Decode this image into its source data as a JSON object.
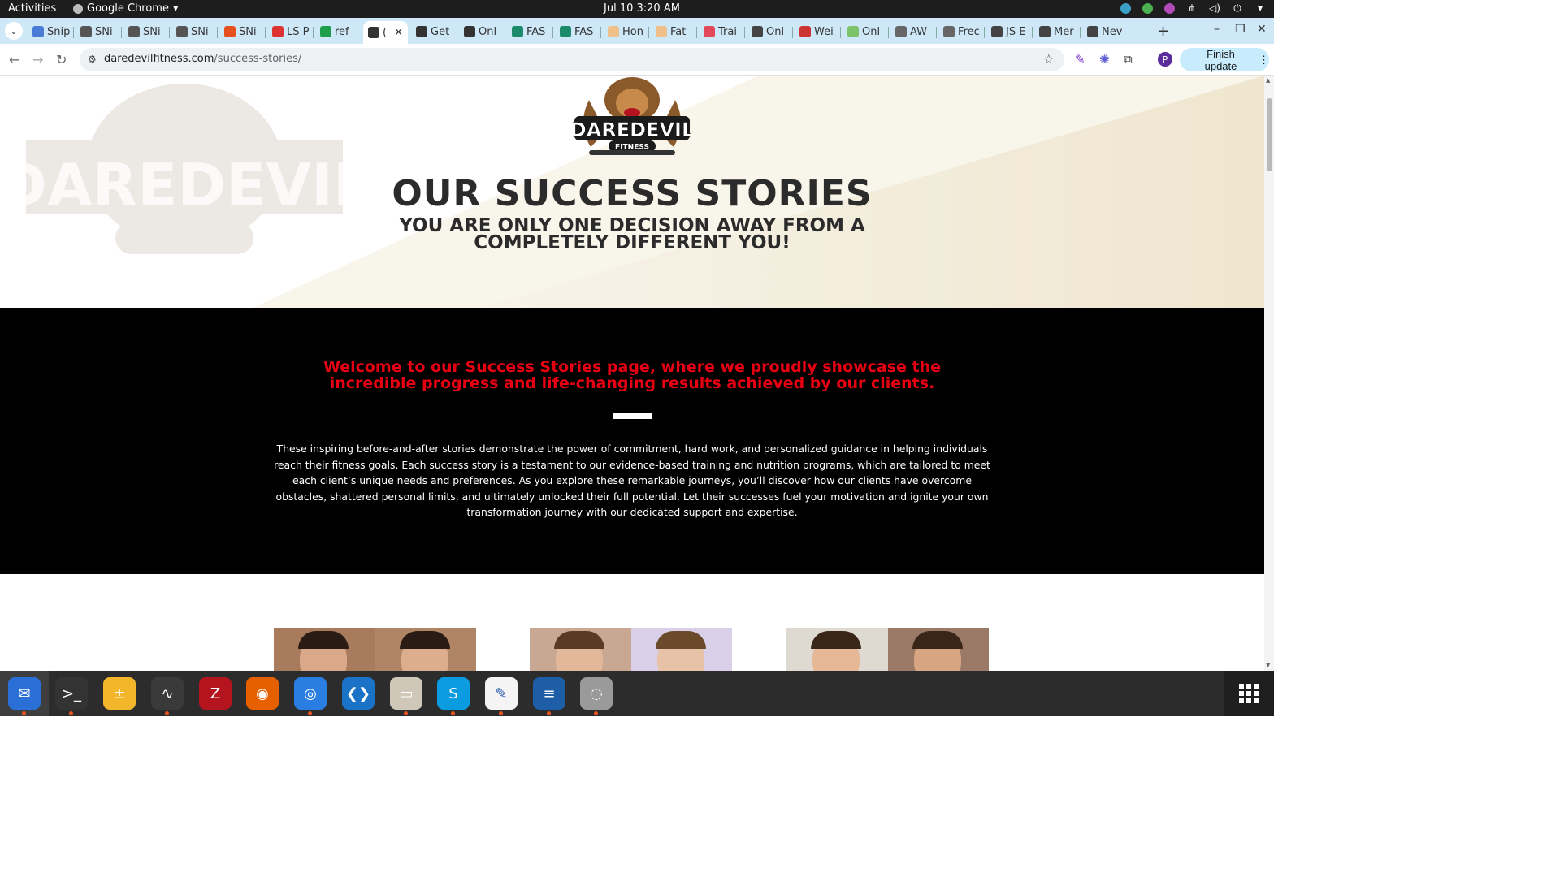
{
  "topbar": {
    "activities": "Activities",
    "app_name": "Google Chrome",
    "clock": "Jul 10  3:20 AM"
  },
  "tabs": [
    {
      "label": "Snip",
      "color": "#4a7bd6"
    },
    {
      "label": "SNi",
      "color": "#555"
    },
    {
      "label": "SNi",
      "color": "#555"
    },
    {
      "label": "SNi",
      "color": "#555"
    },
    {
      "label": "SNi",
      "color": "#e5501e"
    },
    {
      "label": "LS P",
      "color": "#d33"
    },
    {
      "label": "ref",
      "color": "#1e9d4b"
    },
    {
      "label": "(",
      "color": "#333",
      "active": true
    },
    {
      "label": "Get",
      "color": "#333"
    },
    {
      "label": "Onl",
      "color": "#333"
    },
    {
      "label": "FAS",
      "color": "#1d8a6b"
    },
    {
      "label": "FAS",
      "color": "#1d8a6b"
    },
    {
      "label": "Hon",
      "color": "#f0c08a"
    },
    {
      "label": "Fat",
      "color": "#f0c08a"
    },
    {
      "label": "Trai",
      "color": "#e24a5b"
    },
    {
      "label": "Onl",
      "color": "#444"
    },
    {
      "label": "Wei",
      "color": "#c33"
    },
    {
      "label": "Onl",
      "color": "#7cc36a"
    },
    {
      "label": "AW",
      "color": "#666"
    },
    {
      "label": "Frec",
      "color": "#666"
    },
    {
      "label": "JS E",
      "color": "#444"
    },
    {
      "label": "Mer",
      "color": "#444"
    },
    {
      "label": "Nev",
      "color": "#444"
    }
  ],
  "toolbar": {
    "url_host": "daredevilfitness.com",
    "url_path": "/success-stories/",
    "avatar_letter": "P",
    "finish_update": "Finish update"
  },
  "hero": {
    "logo_text": "DAREDEVIL",
    "logo_sub": "FITNESS",
    "title": "OUR SUCCESS STORIES",
    "subtitle": "YOU ARE ONLY ONE DECISION AWAY FROM A COMPLETELY DIFFERENT YOU!"
  },
  "band": {
    "welcome": "Welcome to our Success Stories page, where we proudly showcase the incredible progress and life-changing results achieved by our clients.",
    "intro": "These inspiring before-and-after stories demonstrate the power of commitment, hard work, and personalized guidance in helping individuals reach their fitness goals. Each success story is a testament to our evidence-based training and nutrition programs, which are tailored to meet each client’s unique needs and preferences. As you explore these remarkable journeys, you’ll discover how our clients have overcome obstacles, shattered personal limits, and ultimately unlocked their full potential. Let their successes fuel your motivation and ignite your own transformation journey with our dedicated support and expertise."
  },
  "dock": [
    {
      "name": "thunderbird-icon",
      "glyph": "✉",
      "bg": "#2a6fd6"
    },
    {
      "name": "terminal-icon",
      "glyph": ">_",
      "bg": "#333"
    },
    {
      "name": "calculator-icon",
      "glyph": "±",
      "bg": "#f3b52a"
    },
    {
      "name": "system-monitor-icon",
      "glyph": "∿",
      "bg": "#3a3a3a"
    },
    {
      "name": "filezilla-icon",
      "glyph": "Z",
      "bg": "#b3141d"
    },
    {
      "name": "firefox-icon",
      "glyph": "◉",
      "bg": "#e66000"
    },
    {
      "name": "chrome-icon",
      "glyph": "◎",
      "bg": "#2a7de1"
    },
    {
      "name": "vscode-icon",
      "glyph": "❮❯",
      "bg": "#1a73c6"
    },
    {
      "name": "files-icon",
      "glyph": "▭",
      "bg": "#cfc8b8"
    },
    {
      "name": "skype-icon",
      "glyph": "S",
      "bg": "#0a9be0"
    },
    {
      "name": "text-editor-icon",
      "glyph": "✎",
      "bg": "#f4f4f4"
    },
    {
      "name": "writer-icon",
      "glyph": "≡",
      "bg": "#1d5ea6"
    },
    {
      "name": "disk-icon",
      "glyph": "◌",
      "bg": "#9a9a9a"
    }
  ]
}
